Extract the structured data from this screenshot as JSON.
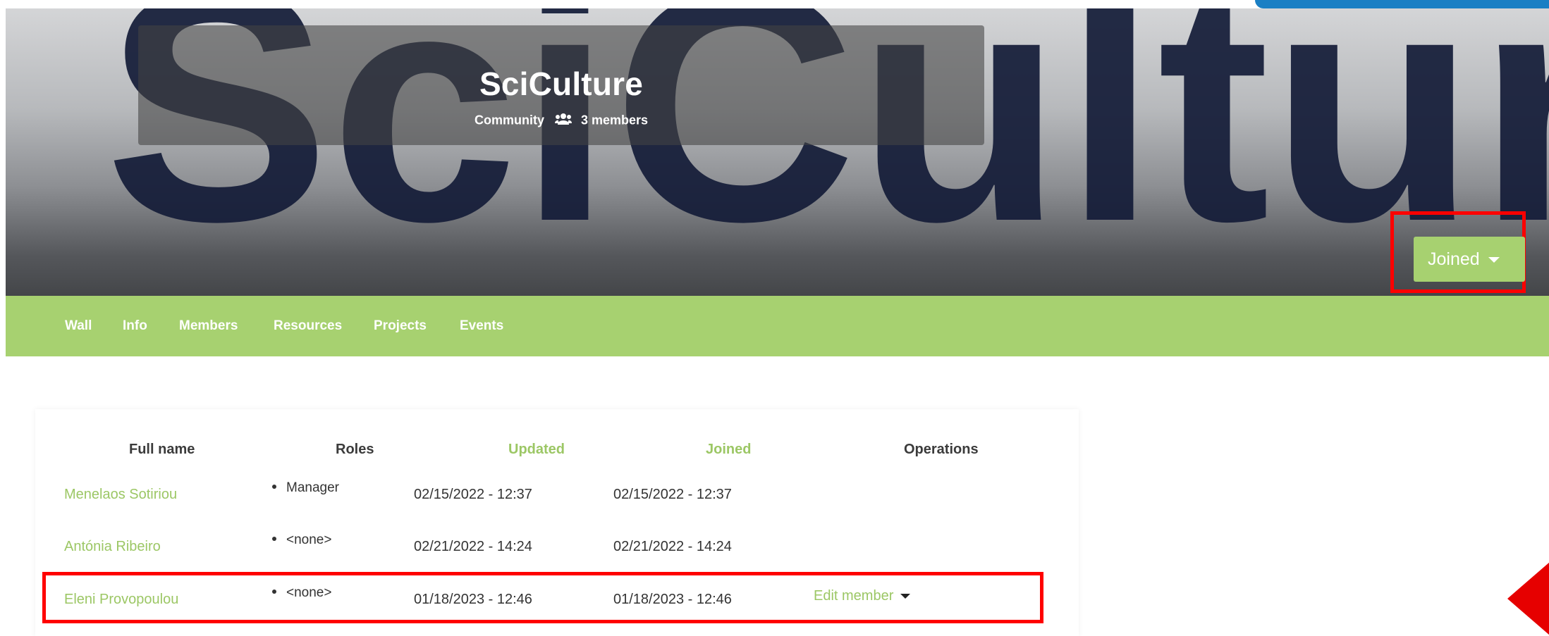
{
  "banner": {
    "art_text": "SciCulture",
    "title": "SciCulture",
    "type_label": "Community",
    "member_count": "3 members",
    "joined_button": "Joined"
  },
  "tabs": [
    "Wall",
    "Info",
    "Members",
    "Resources",
    "Projects",
    "Events"
  ],
  "members_table": {
    "headers": {
      "full_name": "Full name",
      "roles": "Roles",
      "updated": "Updated",
      "joined": "Joined",
      "operations": "Operations"
    },
    "rows": [
      {
        "name": "Menelaos Sotiriou",
        "role": "Manager",
        "updated": "02/15/2022 - 12:37",
        "joined": "02/15/2022 - 12:37",
        "operation": ""
      },
      {
        "name": "Antónia Ribeiro",
        "role": "<none>",
        "updated": "02/21/2022 - 14:24",
        "joined": "02/21/2022 - 14:24",
        "operation": ""
      },
      {
        "name": "Eleni Provopoulou",
        "role": "<none>",
        "updated": "01/18/2023 - 12:46",
        "joined": "01/18/2023 - 12:46",
        "operation": "Edit member"
      }
    ]
  },
  "colors": {
    "accent_green": "#a7d170",
    "link_green": "#9cc765",
    "highlight_red": "#ff0000",
    "banner_art": "#141c38"
  },
  "icons": [
    "users-icon",
    "caret-down-icon",
    "arrow-left-icon"
  ]
}
